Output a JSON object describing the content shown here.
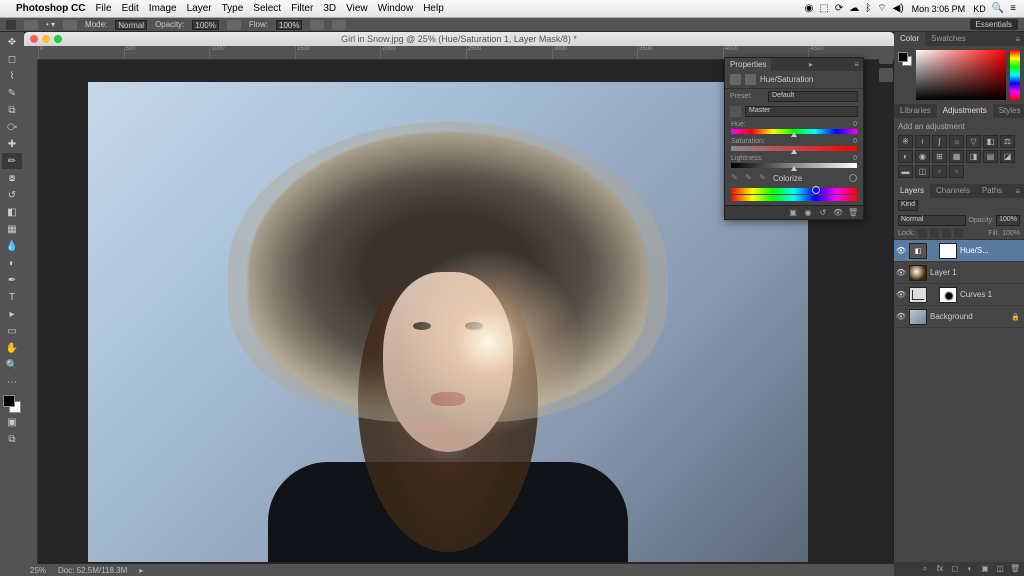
{
  "mac": {
    "app": "Photoshop CC",
    "menus": [
      "File",
      "Edit",
      "Image",
      "Layer",
      "Type",
      "Select",
      "Filter",
      "3D",
      "View",
      "Window",
      "Help"
    ],
    "time": "Mon 3:06 PM",
    "user": "KD"
  },
  "options": {
    "mode_label": "Mode:",
    "mode": "Normal",
    "opacity_label": "Opacity:",
    "opacity": "100%",
    "flow_label": "Flow:",
    "flow": "100%",
    "workspace": "Essentials"
  },
  "document": {
    "title": "Girl in Snow.jpg @ 25% (Hue/Saturation 1, Layer Mask/8) *"
  },
  "ruler_marks": [
    "0",
    "500",
    "1000",
    "1500",
    "2000",
    "2500",
    "3000",
    "3500",
    "4000",
    "4500"
  ],
  "status": {
    "zoom": "25%",
    "doc": "Doc: 52.5M/118.3M"
  },
  "panels": {
    "color": {
      "tabs": [
        "Color",
        "Swatches"
      ]
    },
    "libraries": {
      "tabs": [
        "Libraries",
        "Adjustments",
        "Styles"
      ],
      "active": 1,
      "title": "Add an adjustment"
    },
    "layers": {
      "tabs": [
        "Layers",
        "Channels",
        "Paths"
      ],
      "kind": "Kind",
      "blend": "Normal",
      "opacity_label": "Opacity:",
      "opacity": "100%",
      "lock_label": "Lock:",
      "fill_label": "Fill:",
      "fill": "100%",
      "items": [
        {
          "name": "Hue/S..."
        },
        {
          "name": "Layer 1"
        },
        {
          "name": "Curves 1"
        },
        {
          "name": "Background"
        }
      ]
    }
  },
  "properties": {
    "tab": "Properties",
    "type": "Hue/Saturation",
    "preset_label": "Preset:",
    "preset": "Default",
    "channel": "Master",
    "hue_label": "Hue:",
    "hue": "0",
    "sat_label": "Saturation:",
    "sat": "0",
    "light_label": "Lightness:",
    "light": "0",
    "colorize": "Colorize"
  }
}
